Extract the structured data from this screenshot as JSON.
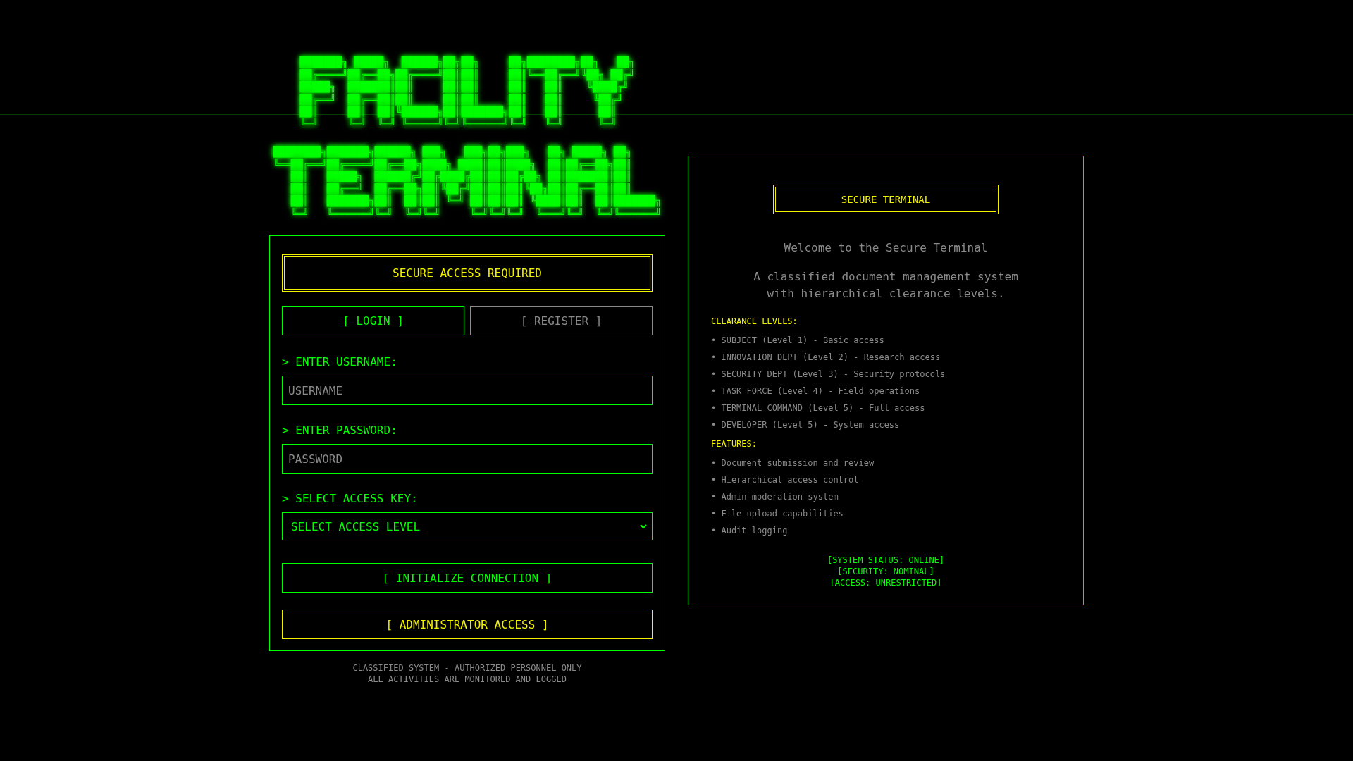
{
  "logo": {
    "blocks": [
      [
        "███████╗ █████╗  ██████╗██╗██╗     ██╗████████╗██╗   ██╗",
        "██╔════╝██╔══██╗██╔════╝██║██║     ██║╚══██╔══╝╚██╗ ██╔╝",
        "█████╗  ███████║██║     ██║██║     ██║   ██║    ╚████╔╝ ",
        "██╔══╝  ██╔══██║██║     ██║██║     ██║   ██║     ╚██╔╝  ",
        "██║     ██║  ██║╚██████╗██║███████╗██║   ██║      ██║   ",
        "╚═╝     ╚═╝  ╚═╝ ╚═════╝╚═╝╚══════╝╚═╝   ╚═╝      ╚═╝   "
      ],
      [
        "████████╗███████╗██████╗ ███╗   ███╗██╗███╗   ██╗ █████╗ ██╗     ",
        "╚══██╔══╝██╔════╝██╔══██╗████╗ ████║██║████╗  ██║██╔══██╗██║     ",
        "   ██║   █████╗  ██████╔╝██╔████╔██║██║██╔██╗ ██║███████║██║     ",
        "   ██║   ██╔══╝  ██╔══██╗██║╚██╔╝██║██║██║╚██╗██║██╔══██║██║     ",
        "   ██║   ███████╗██║  ██║██║ ╚═╝ ██║██║██║ ╚████║██║  ██║███████╗",
        "   ╚═╝   ╚══════╝╚═╝  ╚═╝╚═╝     ╚═╝╚═╝╚═╝  ╚═══╝╚═╝  ╚═╝╚══════╝"
      ]
    ]
  },
  "login": {
    "title": "SECURE ACCESS REQUIRED",
    "tabs": [
      {
        "label": "[ LOGIN ]",
        "selected": true
      },
      {
        "label": "[ REGISTER ]",
        "selected": false
      }
    ],
    "fields": [
      {
        "kind": "text",
        "label": "> ENTER USERNAME:",
        "placeholder": "USERNAME"
      },
      {
        "kind": "password",
        "label": "> ENTER PASSWORD:",
        "placeholder": "PASSWORD"
      },
      {
        "kind": "select",
        "label": "> SELECT ACCESS KEY:",
        "value": "SELECT ACCESS LEVEL"
      }
    ],
    "buttons": [
      {
        "kind": "primary",
        "label": "[ INITIALIZE CONNECTION ]"
      },
      {
        "kind": "admin",
        "label": "[ ADMINISTRATOR ACCESS ]"
      }
    ]
  },
  "footer": [
    "CLASSIFIED SYSTEM - AUTHORIZED PERSONNEL ONLY",
    "ALL ACTIVITIES ARE MONITORED AND LOGGED"
  ],
  "info": {
    "title": "SECURE TERMINAL",
    "welcome": "Welcome to the Secure Terminal",
    "description": "A classified document management system with hierarchical clearance levels.",
    "sections": [
      {
        "heading": "CLEARANCE LEVELS:",
        "items": [
          "• SUBJECT (Level 1) - Basic access",
          "• INNOVATION DEPT (Level 2) - Research access",
          "• SECURITY DEPT (Level 3) - Security protocols",
          "• TASK FORCE (Level 4) - Field operations",
          "• TERMINAL COMMAND (Level 5) - Full access",
          "• DEVELOPER (Level 5) - System access"
        ]
      },
      {
        "heading": "FEATURES:",
        "items": [
          "• Document submission and review",
          "• Hierarchical access control",
          "• Admin moderation system",
          "• File upload capabilities",
          "• Audit logging"
        ]
      }
    ],
    "status": [
      "[SYSTEM STATUS: ONLINE]",
      "[SECURITY: NOMINAL]",
      "[ACCESS: UNRESTRICTED]"
    ]
  }
}
